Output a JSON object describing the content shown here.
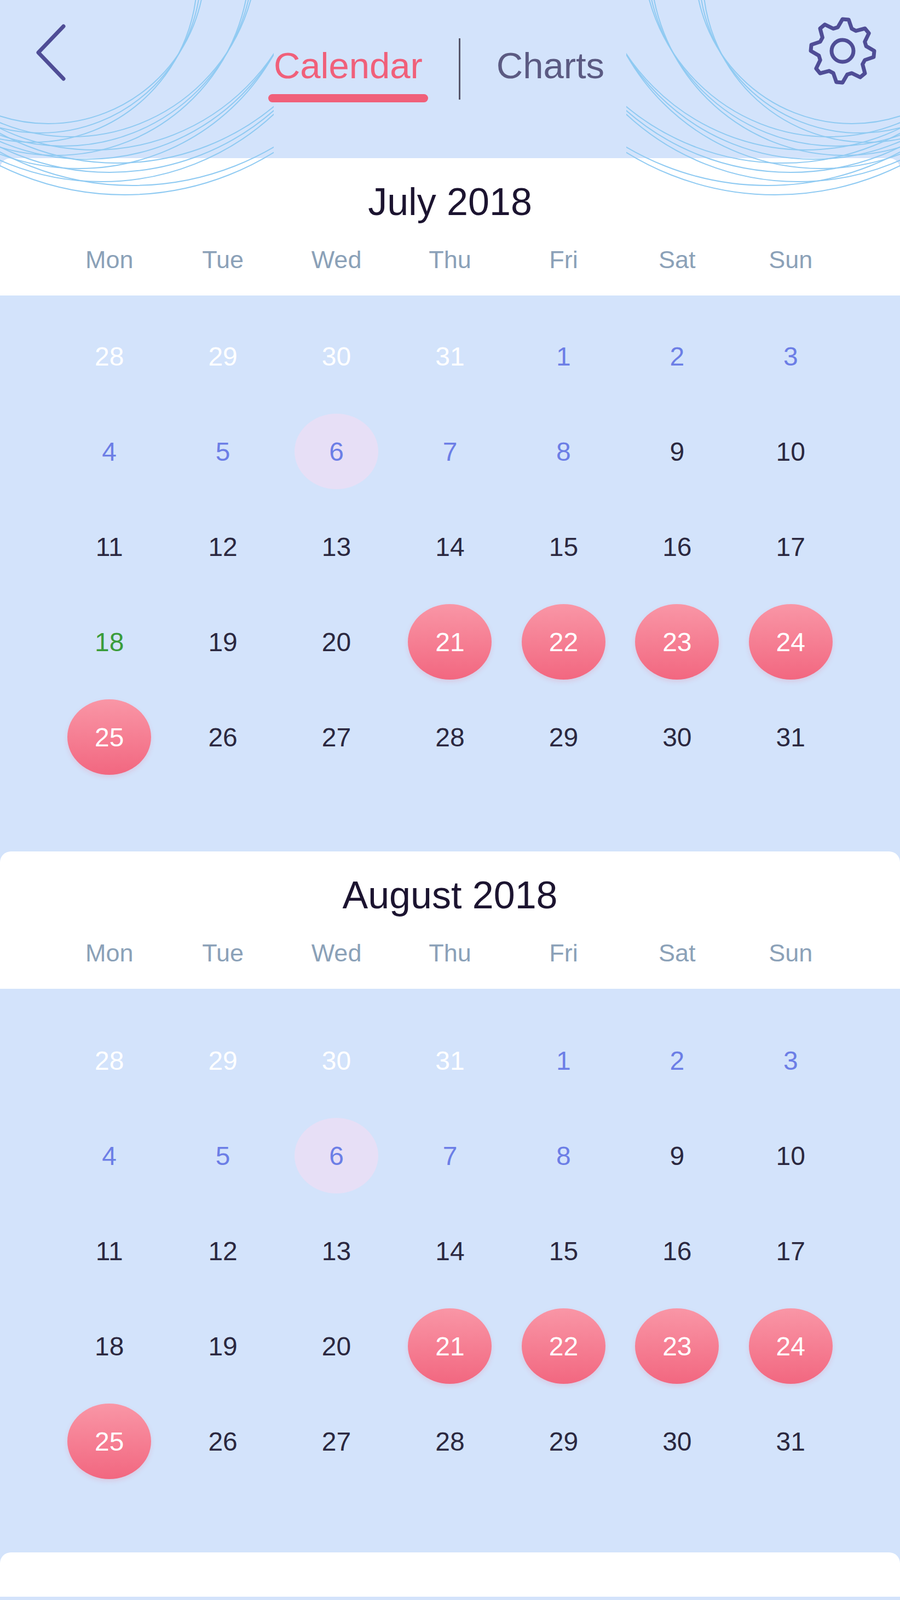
{
  "tabs": [
    {
      "label": "Calendar",
      "selected": true
    },
    {
      "label": "Charts",
      "selected": false
    }
  ],
  "months": [
    {
      "title": "July 2018",
      "weekdays": [
        "Mon",
        "Tue",
        "Wed",
        "Thu",
        "Fri",
        "Sat",
        "Sun"
      ],
      "days": [
        {
          "text": "28",
          "kind": "outside"
        },
        {
          "text": "29",
          "kind": "outside"
        },
        {
          "text": "30",
          "kind": "outside"
        },
        {
          "text": "31",
          "kind": "outside"
        },
        {
          "text": "1",
          "kind": "muted"
        },
        {
          "text": "2",
          "kind": "muted"
        },
        {
          "text": "3",
          "kind": "muted"
        },
        {
          "text": "4",
          "kind": "muted"
        },
        {
          "text": "5",
          "kind": "muted"
        },
        {
          "text": "6",
          "kind": "marked"
        },
        {
          "text": "7",
          "kind": "muted"
        },
        {
          "text": "8",
          "kind": "muted"
        },
        {
          "text": "9",
          "kind": "normal"
        },
        {
          "text": "10",
          "kind": "normal"
        },
        {
          "text": "11",
          "kind": "normal"
        },
        {
          "text": "12",
          "kind": "normal"
        },
        {
          "text": "13",
          "kind": "normal"
        },
        {
          "text": "14",
          "kind": "normal"
        },
        {
          "text": "15",
          "kind": "normal"
        },
        {
          "text": "16",
          "kind": "normal"
        },
        {
          "text": "17",
          "kind": "normal"
        },
        {
          "text": "18",
          "kind": "today"
        },
        {
          "text": "19",
          "kind": "normal"
        },
        {
          "text": "20",
          "kind": "normal"
        },
        {
          "text": "21",
          "kind": "period"
        },
        {
          "text": "22",
          "kind": "period"
        },
        {
          "text": "23",
          "kind": "period"
        },
        {
          "text": "24",
          "kind": "period"
        },
        {
          "text": "25",
          "kind": "period"
        },
        {
          "text": "26",
          "kind": "normal"
        },
        {
          "text": "27",
          "kind": "normal"
        },
        {
          "text": "28",
          "kind": "normal"
        },
        {
          "text": "29",
          "kind": "normal"
        },
        {
          "text": "30",
          "kind": "normal"
        },
        {
          "text": "31",
          "kind": "normal"
        }
      ]
    },
    {
      "title": "August 2018",
      "weekdays": [
        "Mon",
        "Tue",
        "Wed",
        "Thu",
        "Fri",
        "Sat",
        "Sun"
      ],
      "days": [
        {
          "text": "28",
          "kind": "outside"
        },
        {
          "text": "29",
          "kind": "outside"
        },
        {
          "text": "30",
          "kind": "outside"
        },
        {
          "text": "31",
          "kind": "outside"
        },
        {
          "text": "1",
          "kind": "muted"
        },
        {
          "text": "2",
          "kind": "muted"
        },
        {
          "text": "3",
          "kind": "muted"
        },
        {
          "text": "4",
          "kind": "muted"
        },
        {
          "text": "5",
          "kind": "muted"
        },
        {
          "text": "6",
          "kind": "marked"
        },
        {
          "text": "7",
          "kind": "muted"
        },
        {
          "text": "8",
          "kind": "muted"
        },
        {
          "text": "9",
          "kind": "normal"
        },
        {
          "text": "10",
          "kind": "normal"
        },
        {
          "text": "11",
          "kind": "normal"
        },
        {
          "text": "12",
          "kind": "normal"
        },
        {
          "text": "13",
          "kind": "normal"
        },
        {
          "text": "14",
          "kind": "normal"
        },
        {
          "text": "15",
          "kind": "normal"
        },
        {
          "text": "16",
          "kind": "normal"
        },
        {
          "text": "17",
          "kind": "normal"
        },
        {
          "text": "18",
          "kind": "normal"
        },
        {
          "text": "19",
          "kind": "normal"
        },
        {
          "text": "20",
          "kind": "normal"
        },
        {
          "text": "21",
          "kind": "period"
        },
        {
          "text": "22",
          "kind": "period"
        },
        {
          "text": "23",
          "kind": "period"
        },
        {
          "text": "24",
          "kind": "period"
        },
        {
          "text": "25",
          "kind": "period"
        },
        {
          "text": "26",
          "kind": "normal"
        },
        {
          "text": "27",
          "kind": "normal"
        },
        {
          "text": "28",
          "kind": "normal"
        },
        {
          "text": "29",
          "kind": "normal"
        },
        {
          "text": "30",
          "kind": "normal"
        },
        {
          "text": "31",
          "kind": "normal"
        }
      ]
    }
  ]
}
